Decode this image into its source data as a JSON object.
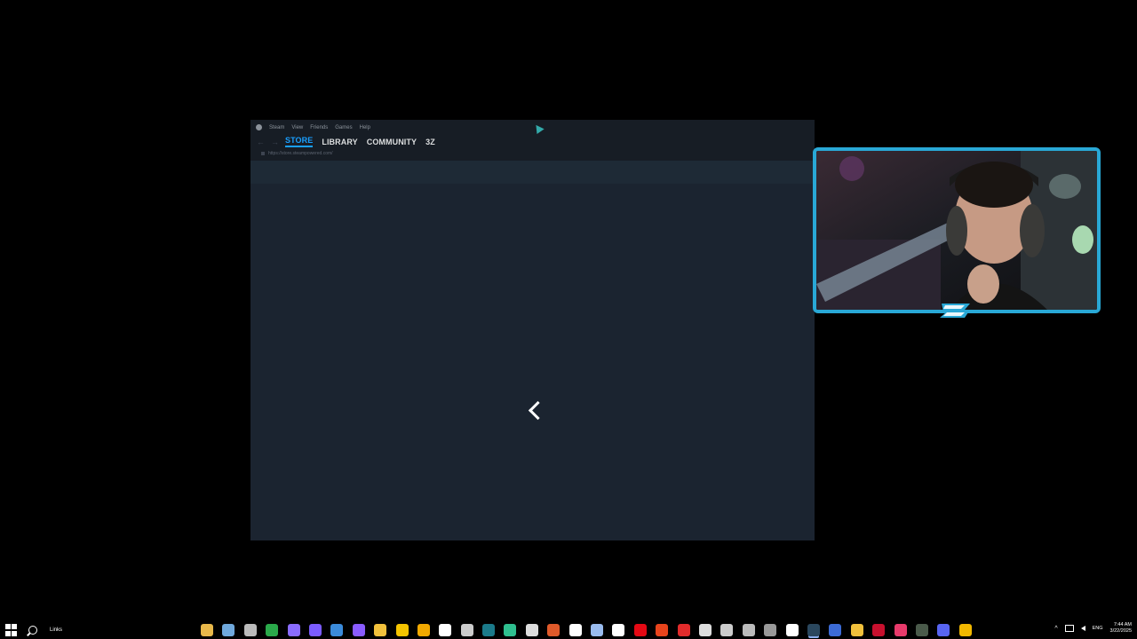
{
  "steam": {
    "menu": [
      "Steam",
      "View",
      "Friends",
      "Games",
      "Help"
    ],
    "nav": {
      "back_icon": "arrow-left-icon",
      "forward_icon": "arrow-right-icon",
      "store": "STORE",
      "library": "LIBRARY",
      "community": "COMMUNITY",
      "user": "3Z"
    },
    "url": "https://store.steampowered.com/",
    "accent": "#1a9fff",
    "loading_icon": "chevron-left-icon"
  },
  "webcam": {
    "border_color": "#29a8d6",
    "logo_icon": "z-logo-icon"
  },
  "taskbar": {
    "links_label": "Links",
    "language": "ENG",
    "time": "7:44 AM",
    "date": "3/22/2025",
    "apps": [
      {
        "name": "file-explorer-icon",
        "color": "#e8b84a"
      },
      {
        "name": "recycle-icon",
        "color": "#6fa8dc"
      },
      {
        "name": "app-icon",
        "color": "#bbbbbb"
      },
      {
        "name": "xbox-icon",
        "color": "#2aa94a"
      },
      {
        "name": "app-purple-icon",
        "color": "#8a6cff"
      },
      {
        "name": "grid-app-icon",
        "color": "#7b5cff"
      },
      {
        "name": "shield-icon",
        "color": "#3b8bdb"
      },
      {
        "name": "video-editor-icon",
        "color": "#8a5cff"
      },
      {
        "name": "app-yellow-icon",
        "color": "#f2c13c"
      },
      {
        "name": "norton-icon",
        "color": "#f5c400"
      },
      {
        "name": "rockstar-icon",
        "color": "#f2a900"
      },
      {
        "name": "calendar-icon",
        "color": "#ffffff"
      },
      {
        "name": "obs-icon",
        "color": "#cccccc"
      },
      {
        "name": "app-teal-icon",
        "color": "#1b7a8a"
      },
      {
        "name": "app-green-icon",
        "color": "#2fbf8f"
      },
      {
        "name": "app-bird-icon",
        "color": "#dddddd"
      },
      {
        "name": "app-red-icon",
        "color": "#e05a2a"
      },
      {
        "name": "app-x-icon",
        "color": "#ffffff"
      },
      {
        "name": "app-ship-icon",
        "color": "#99bbee"
      },
      {
        "name": "document-icon",
        "color": "#ffffff"
      },
      {
        "name": "netflix-icon",
        "color": "#e50914"
      },
      {
        "name": "app-orange-icon",
        "color": "#e8441c"
      },
      {
        "name": "youtube-icon",
        "color": "#e22b2b"
      },
      {
        "name": "epic-icon",
        "color": "#dddddd"
      },
      {
        "name": "app-circle-icon",
        "color": "#cccccc"
      },
      {
        "name": "app-ball-icon",
        "color": "#bbbbbb"
      },
      {
        "name": "settings-icon",
        "color": "#999999"
      },
      {
        "name": "app-mail-icon",
        "color": "#ffffff"
      },
      {
        "name": "steam-icon",
        "color": "#2a475e",
        "active": true
      },
      {
        "name": "app-blue-icon",
        "color": "#3c6bd6"
      },
      {
        "name": "app-smile-icon",
        "color": "#f2c13c"
      },
      {
        "name": "adobe-icon",
        "color": "#c8102e"
      },
      {
        "name": "app-pink-icon",
        "color": "#e83a6b"
      },
      {
        "name": "app-dark-icon",
        "color": "#4a5a4a"
      },
      {
        "name": "discord-icon",
        "color": "#5865f2"
      },
      {
        "name": "chrome-icon",
        "color": "#f2b800"
      }
    ]
  }
}
